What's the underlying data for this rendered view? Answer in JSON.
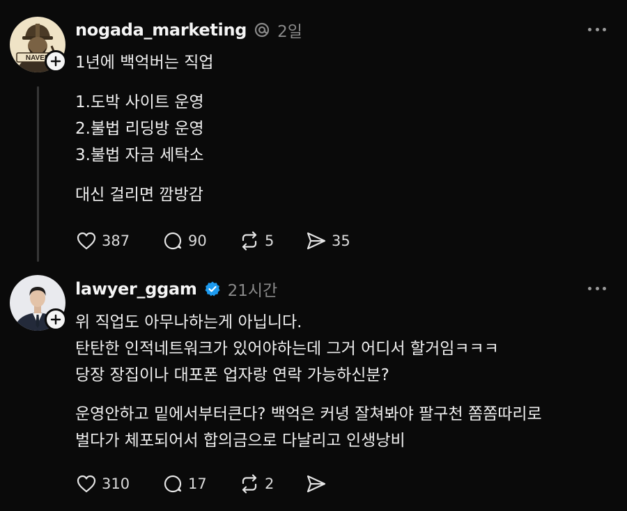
{
  "posts": [
    {
      "username": "nogada_marketing",
      "badge_icon": "threads-icon",
      "time": "2일",
      "avatar_text": "NAVER",
      "paragraphs": [
        "1년에 백억버는 직업",
        "1.도박 사이트 운영",
        "2.불법 리딩방 운영",
        "3.불법 자금 세탁소",
        "대신 걸리면 깜방감"
      ],
      "actions": {
        "likes": "387",
        "comments": "90",
        "reposts": "5",
        "shares": "35"
      }
    },
    {
      "username": "lawyer_ggam",
      "badge_icon": "verified-check-icon",
      "badge_color": "#1d9bf0",
      "time": "21시간",
      "paragraphs": [
        "위 직업도 아무나하는게 아닙니다.",
        "탄탄한 인적네트워크가 있어야하는데 그거 어디서 할거임ㅋㅋㅋ",
        "당장 장집이나 대포폰 업자랑 연락 가능하신분?",
        "운영안하고 밑에서부터큰다? 백억은 커녕 잘쳐봐야 팔구천 쫌쫌따리로",
        "벌다가 체포되어서 합의금으로 다날리고 인생낭비"
      ],
      "actions": {
        "likes": "310",
        "comments": "17",
        "reposts": "2",
        "shares": ""
      }
    }
  ]
}
